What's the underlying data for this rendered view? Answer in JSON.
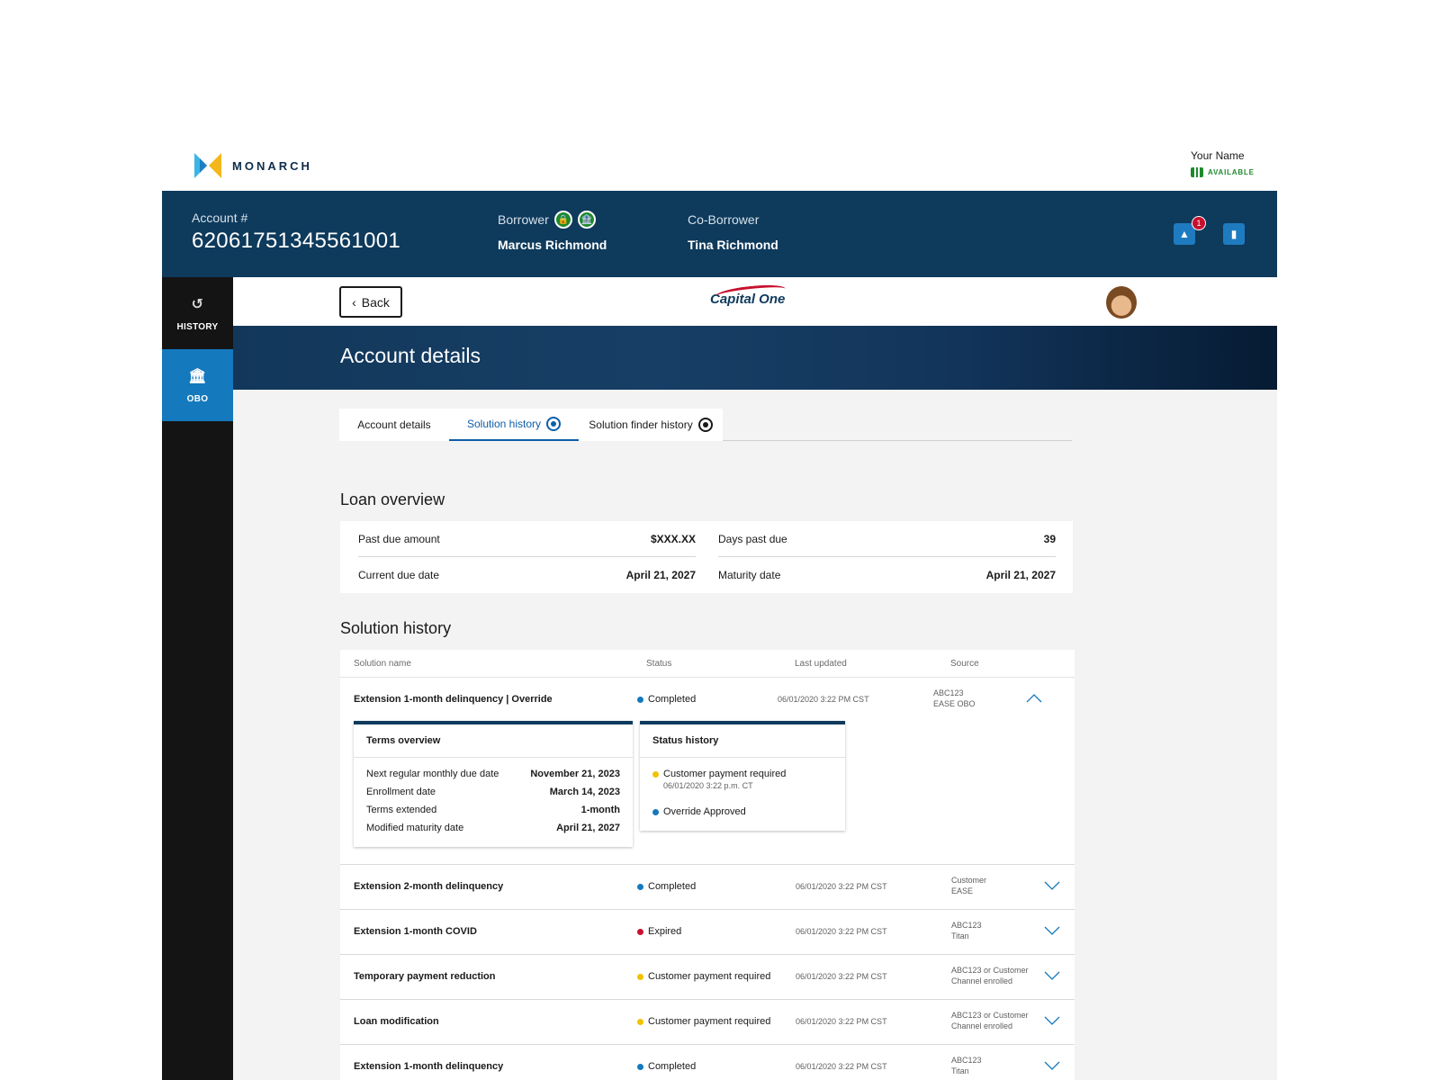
{
  "brand": {
    "name": "MONARCH"
  },
  "user": {
    "name": "Your Name",
    "status": "AVAILABLE"
  },
  "account": {
    "label": "Account #",
    "number": "62061751345561001",
    "borrower_label": "Borrower",
    "borrower_name": "Marcus Richmond",
    "coborrower_label": "Co-Borrower",
    "coborrower_name": "Tina Richmond",
    "notifications_count": "1"
  },
  "sidebar": {
    "items": [
      {
        "label": "HISTORY",
        "icon": "history-icon"
      },
      {
        "label": "OBO",
        "icon": "bank-icon"
      }
    ]
  },
  "topbar": {
    "back_label": "Back",
    "company_logo": "Capital One"
  },
  "hero": {
    "title": "Account details"
  },
  "tabs": [
    {
      "label": "Account details"
    },
    {
      "label": "Solution history"
    },
    {
      "label": "Solution finder history"
    }
  ],
  "loan_overview": {
    "title": "Loan overview",
    "rows": [
      {
        "label": "Past due amount",
        "value": "$XXX.XX"
      },
      {
        "label": "Days past due",
        "value": "39"
      },
      {
        "label": "Current due date",
        "value": "April 21, 2027"
      },
      {
        "label": "Maturity date",
        "value": "April 21, 2027"
      }
    ]
  },
  "solution_history": {
    "title": "Solution history",
    "headers": [
      "Solution name",
      "Status",
      "Last updated",
      "Source"
    ],
    "expanded": {
      "name": "Extension 1-month delinquency | Override",
      "status": "Completed",
      "status_color": "#1479bd",
      "date": "06/01/2020  3:22 PM CST",
      "source_line1": "ABC123",
      "source_line2": "EASE OBO",
      "terms": {
        "title": "Terms overview",
        "rows": [
          {
            "label": "Next regular monthly due date",
            "value": "November 21, 2023"
          },
          {
            "label": "Enrollment date",
            "value": "March 14, 2023"
          },
          {
            "label": "Terms extended",
            "value": "1-month"
          },
          {
            "label": "Modified maturity date",
            "value": "April 21, 2027"
          }
        ]
      },
      "status_history": {
        "title": "Status history",
        "items": [
          {
            "label": "Customer payment required",
            "sub": "06/01/2020  3:22 p.m. CT",
            "color": "#f2c200"
          },
          {
            "label": "Override Approved",
            "sub": "",
            "color": "#1479bd"
          }
        ]
      }
    },
    "rows": [
      {
        "name": "Extension 2-month delinquency",
        "status": "Completed",
        "status_color": "#1479bd",
        "date": "06/01/2020  3:22 PM CST",
        "source_line1": "Customer",
        "source_line2": "EASE"
      },
      {
        "name": "Extension 1-month COVID",
        "status": "Expired",
        "status_color": "#c8102e",
        "date": "06/01/2020  3:22 PM CST",
        "source_line1": "ABC123",
        "source_line2": "Titan"
      },
      {
        "name": "Temporary payment reduction",
        "status": "Customer payment required",
        "status_color": "#f2c200",
        "date": "06/01/2020  3:22 PM CST",
        "source_line1": "ABC123 or Customer",
        "source_line2": "Channel enrolled"
      },
      {
        "name": "Loan modification",
        "status": "Customer payment required",
        "status_color": "#f2c200",
        "date": "06/01/2020  3:22 PM CST",
        "source_line1": "ABC123 or Customer",
        "source_line2": "Channel enrolled"
      },
      {
        "name": "Extension 1-month delinquency",
        "status": "Completed",
        "status_color": "#1479bd",
        "date": "06/01/2020  3:22 PM CST",
        "source_line1": "ABC123",
        "source_line2": "Titan"
      }
    ]
  }
}
